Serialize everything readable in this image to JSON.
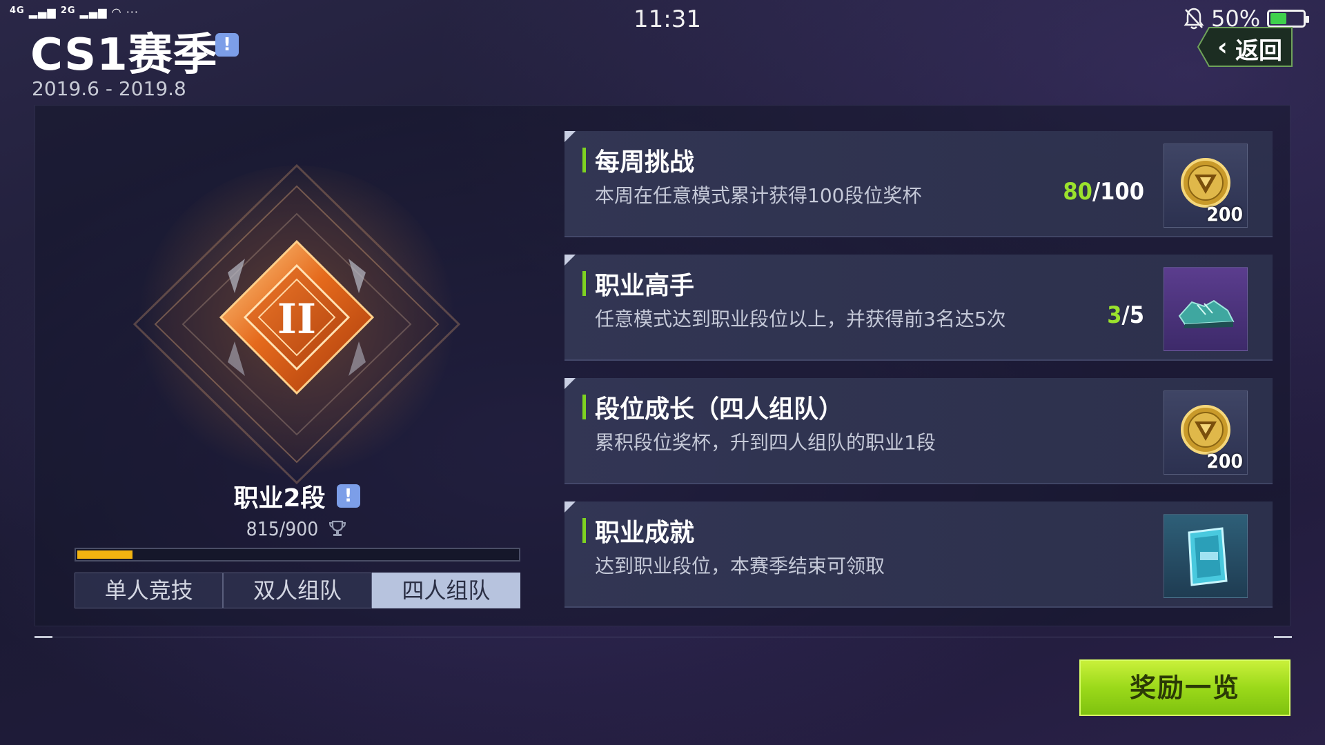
{
  "status_bar": {
    "network_1": "4G",
    "network_2": "2G",
    "more": "···",
    "time": "11:31",
    "battery_text": "50%",
    "battery_level": 0.5
  },
  "header": {
    "title": "CS1赛季",
    "info_icon": "!",
    "date_range": "2019.6 - 2019.8",
    "back_label": "返回"
  },
  "rank": {
    "emblem_numeral": "II",
    "name": "职业2段",
    "info_icon": "!",
    "score": "815/900",
    "progress_fraction": 0.125
  },
  "mode_tabs": [
    {
      "label": "单人竞技",
      "active": false
    },
    {
      "label": "双人组队",
      "active": false
    },
    {
      "label": "四人组队",
      "active": true
    }
  ],
  "tasks": [
    {
      "title": "每周挑战",
      "description": "本周在任意模式累计获得100段位奖杯",
      "progress_current": "80",
      "progress_total": "/100",
      "reward_icon": "gold-coin-icon",
      "reward_count": "200"
    },
    {
      "title": "职业高手",
      "description": "任意模式达到职业段位以上，并获得前3名达5次",
      "progress_current": "3",
      "progress_total": "/5",
      "reward_icon": "sneaker-icon",
      "reward_count": ""
    },
    {
      "title": "段位成长（四人组队）",
      "description": "累积段位奖杯，升到四人组队的职业1段",
      "progress_current": "",
      "progress_total": "",
      "reward_icon": "gold-coin-icon",
      "reward_count": "200"
    },
    {
      "title": "职业成就",
      "description": "达到职业段位，本赛季结束可领取",
      "progress_current": "",
      "progress_total": "",
      "reward_icon": "crystal-card-icon",
      "reward_count": ""
    }
  ],
  "rewards_button": "奖励一览",
  "colors": {
    "accent_green": "#9be22d",
    "progress_yellow": "#f2b310",
    "info_blue": "#7c9ee8"
  }
}
